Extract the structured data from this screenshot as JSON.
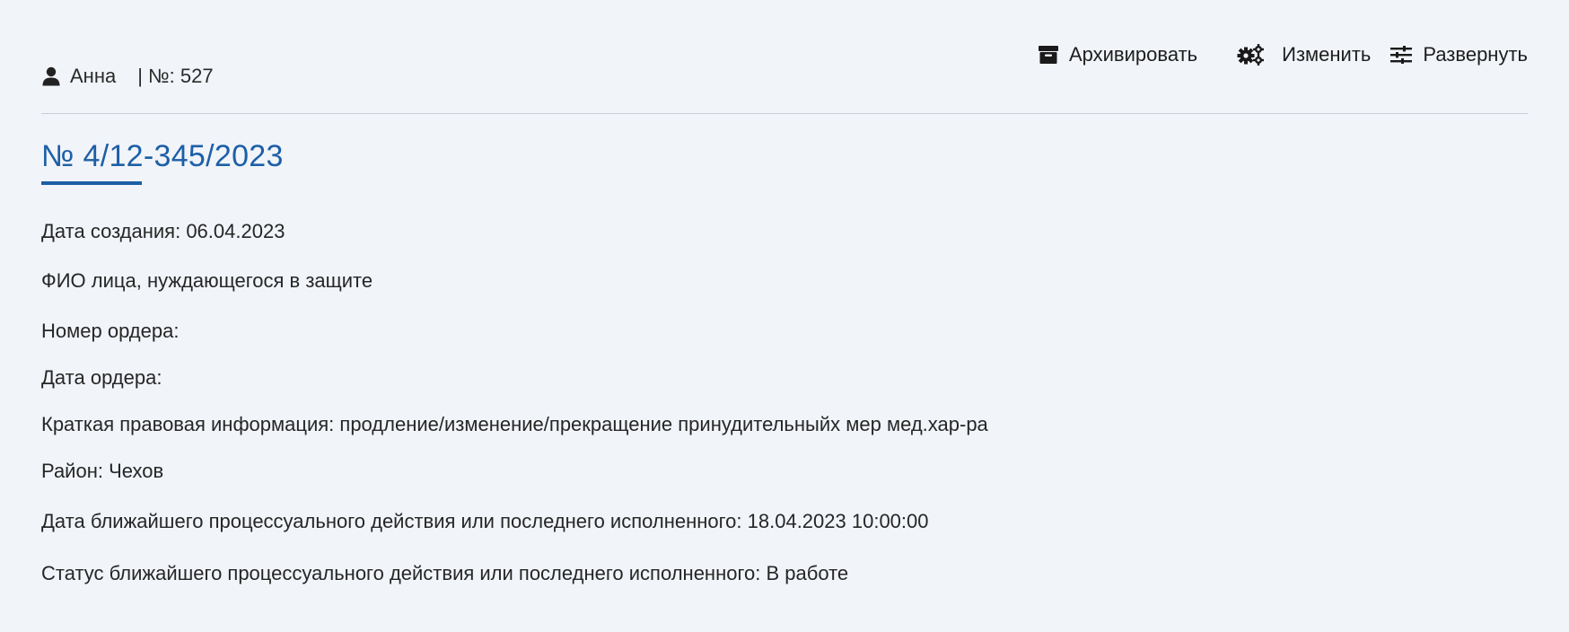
{
  "user": {
    "icon": "user-icon",
    "name": "Анна",
    "number_label": "| №: 527"
  },
  "actions": {
    "archive": {
      "icon": "archive-box-icon",
      "label": "Архивировать"
    },
    "edit": {
      "icon": "gears-icon",
      "label": "Изменить"
    },
    "expand": {
      "icon": "sliders-icon",
      "label": "Развернуть"
    }
  },
  "record": {
    "title": "№ 4/12-345/2023",
    "fields": [
      "Дата создания: 06.04.2023",
      "ФИО лица, нуждающегося в защите",
      "Номер ордера:",
      "Дата ордера:",
      "Краткая правовая информация: продление/изменение/прекращение принудительныйх мер мед.хар-ра",
      "Район: Чехов",
      "Дата ближайшего процессуального действия или последнего исполненного: 18.04.2023 10:00:00",
      "Статус ближайшего процессуального действия или последнего исполненного: В работе"
    ]
  },
  "colors": {
    "background": "#f1f4f9",
    "title": "#1d5fa6",
    "text": "#262626",
    "divider": "#c9ced6"
  }
}
